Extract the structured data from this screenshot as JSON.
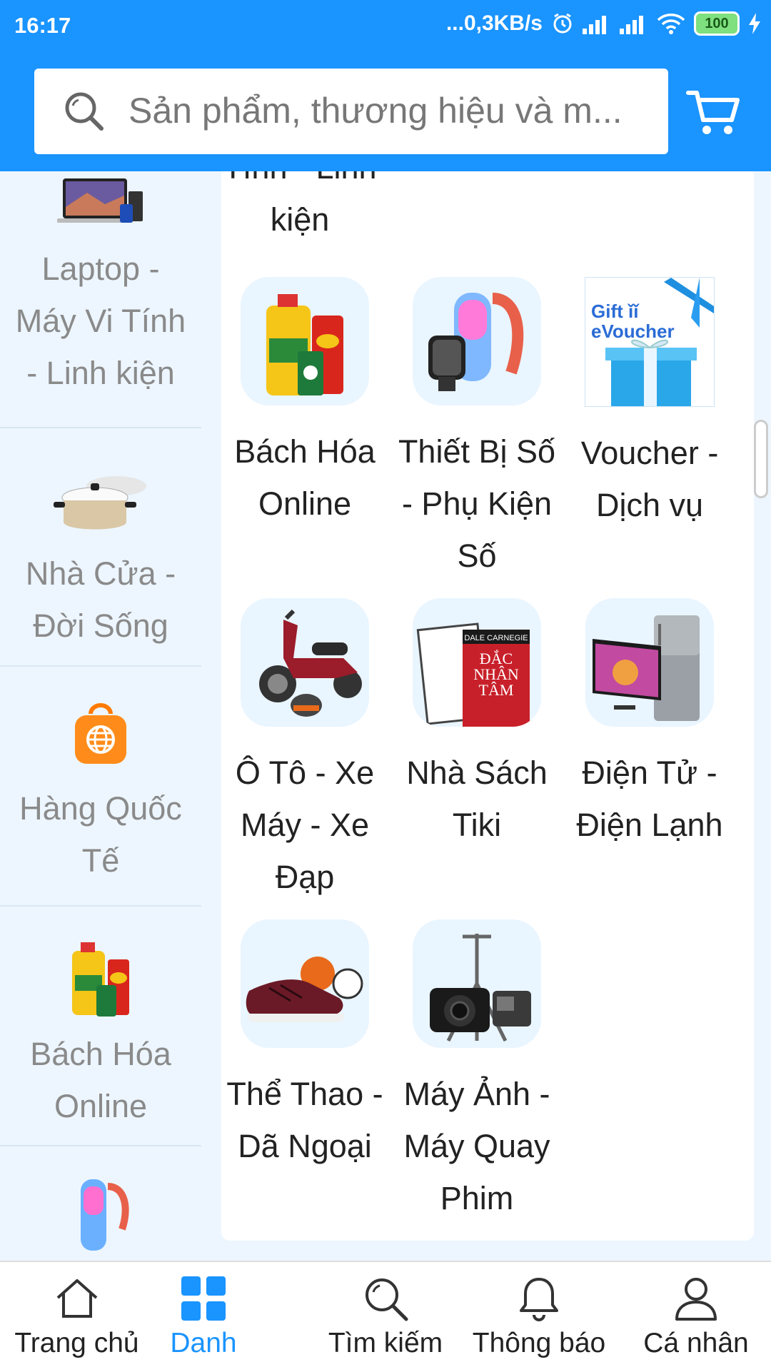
{
  "status_bar": {
    "time": "16:17",
    "network_speed": "...0,3KB/s",
    "battery": "100"
  },
  "header": {
    "search_placeholder": "Sản phẩm, thương hiệu và m..."
  },
  "sidebar": {
    "items": [
      {
        "label": "Laptop - Máy Vi Tính - Linh kiện",
        "icon": "laptop-image"
      },
      {
        "label": "Nhà Cửa - Đời Sống",
        "icon": "cookware-image"
      },
      {
        "label": "Hàng Quốc Tế",
        "icon": "global-shopping-bag-icon"
      },
      {
        "label": "Bách Hóa Online",
        "icon": "grocery-image"
      },
      {
        "label": "",
        "icon": "digital-devices-image"
      }
    ]
  },
  "main": {
    "partial_top_label": "Tính - Linh kiện",
    "categories": [
      {
        "label": "Bách Hóa Online",
        "icon": "grocery-image"
      },
      {
        "label": "Thiết Bị Số - Phụ Kiện Số",
        "icon": "digital-devices-image"
      },
      {
        "label": "Voucher - Dịch vụ",
        "icon": "gift-evoucher-image",
        "tile_text": "Gift eVoucher"
      },
      {
        "label": "Ô Tô - Xe Máy - Xe Đạp",
        "icon": "motorbike-image"
      },
      {
        "label": "Nhà Sách Tiki",
        "icon": "books-image",
        "tile_text": "DALE CARNEGIE ĐẮC NHÂN TÂM"
      },
      {
        "label": "Điện Tử - Điện Lạnh",
        "icon": "tv-fridge-image"
      },
      {
        "label": "Thể Thao - Dã Ngoại",
        "icon": "sports-shoes-image"
      },
      {
        "label": "Máy Ảnh - Máy Quay Phim",
        "icon": "camera-image"
      }
    ]
  },
  "bottom_nav": {
    "items": [
      {
        "label": "Trang chủ",
        "icon": "home-icon"
      },
      {
        "label": "Danh",
        "icon": "category-grid-icon",
        "active": true
      },
      {
        "label": "Tìm kiếm",
        "icon": "search-icon"
      },
      {
        "label": "Thông báo",
        "icon": "bell-icon"
      },
      {
        "label": "Cá nhân",
        "icon": "user-icon"
      }
    ]
  },
  "colors": {
    "primary": "#1a94ff",
    "sidebar_bg": "#edf6ff",
    "sidebar_text": "#8a8a8a"
  }
}
